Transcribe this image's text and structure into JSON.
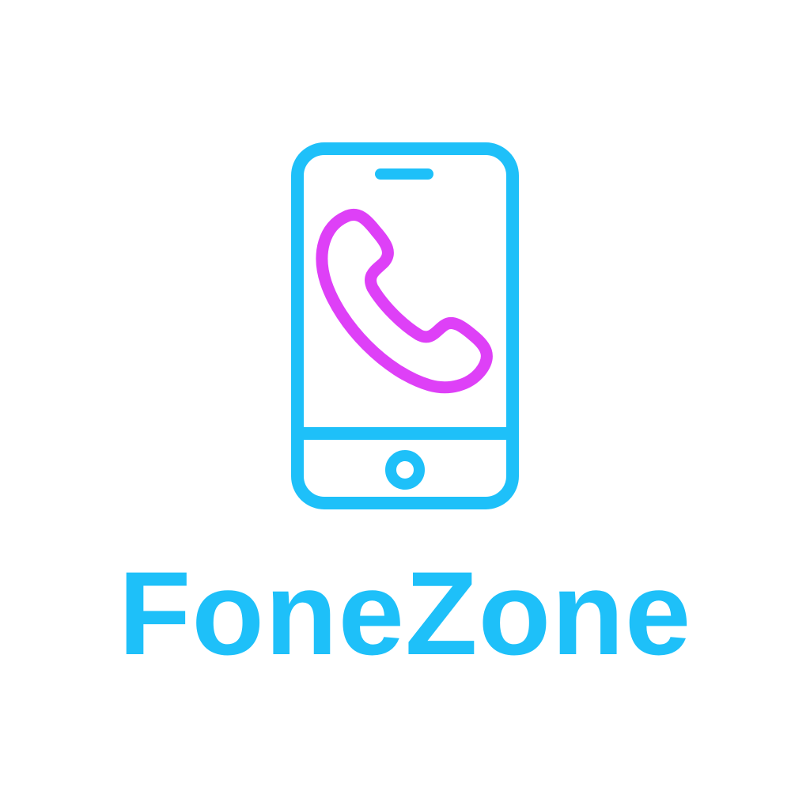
{
  "brand": {
    "name": "FoneZone"
  },
  "icons": {
    "device": "smartphone-icon",
    "call": "phone-call-icon"
  },
  "colors": {
    "primary": "#1ec0f9",
    "accent": "#de40f7",
    "background": "#ffffff"
  }
}
